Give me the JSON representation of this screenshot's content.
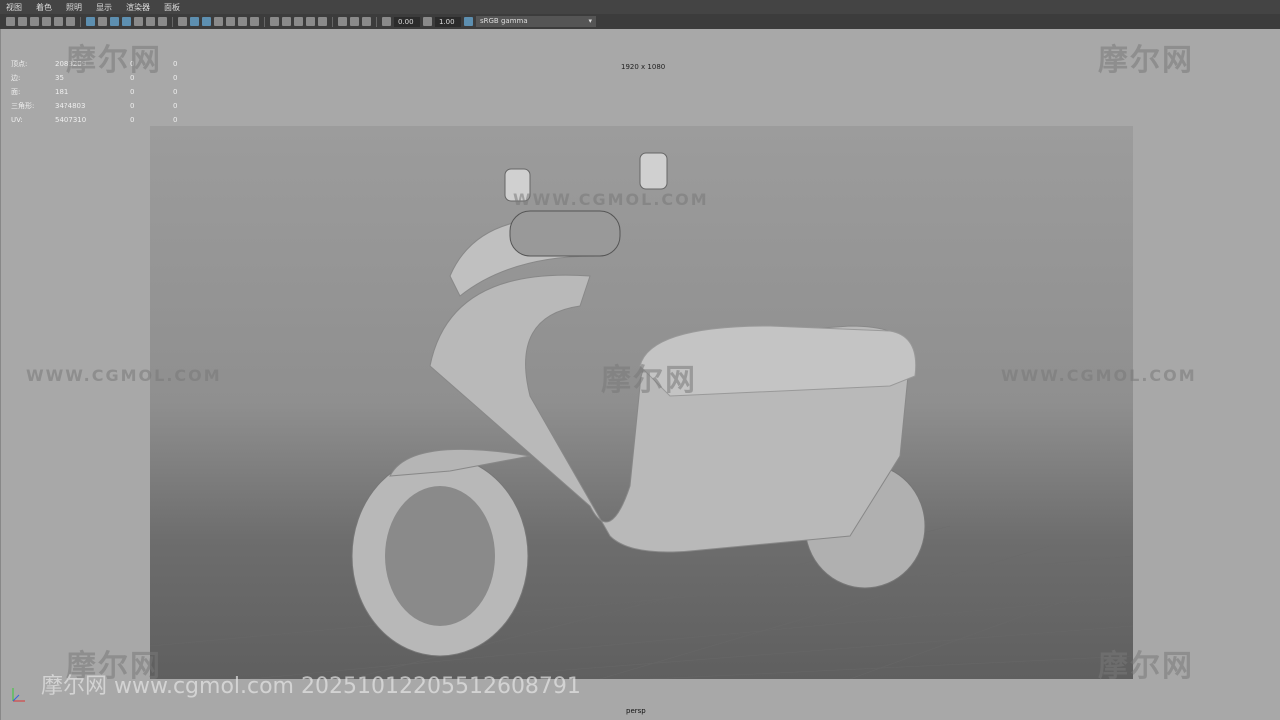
{
  "menu": [
    "视图",
    "着色",
    "照明",
    "显示",
    "渲染器",
    "面板"
  ],
  "toolbar": {
    "exposure": "0.00",
    "gamma": "1.00",
    "color_space": "sRGB gamma"
  },
  "stats": [
    {
      "label": "顶点:",
      "value": "2083209",
      "a": "0",
      "b": "0"
    },
    {
      "label": "边:",
      "value": "35",
      "a": "0",
      "b": "0"
    },
    {
      "label": "面:",
      "value": "181",
      "a": "0",
      "b": "0"
    },
    {
      "label": "三角形:",
      "value": "34?4803",
      "a": "0",
      "b": "0"
    },
    {
      "label": "UV:",
      "value": "5407310",
      "a": "0",
      "b": "0"
    }
  ],
  "resolution": "1920 x 1080",
  "camera": "persp",
  "watermark": {
    "logo": "摩尔网",
    "url": "WWW.CGMOL.COM",
    "footer": "摩尔网 www.cgmol.com 20251012205512608791"
  }
}
